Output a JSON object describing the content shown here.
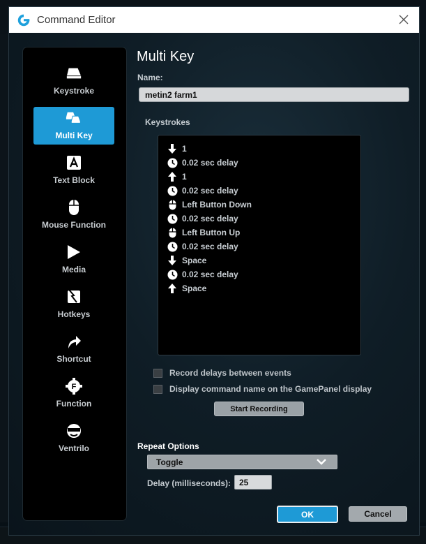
{
  "window": {
    "title": "Command Editor"
  },
  "sidebar": {
    "items": [
      {
        "label": "Keystroke",
        "icon": "keycap-icon",
        "active": false
      },
      {
        "label": "Multi Key",
        "icon": "multi-keycap-icon",
        "active": true
      },
      {
        "label": "Text Block",
        "icon": "letter-a-icon",
        "active": false
      },
      {
        "label": "Mouse Function",
        "icon": "mouse-icon",
        "active": false
      },
      {
        "label": "Media",
        "icon": "play-icon",
        "active": false
      },
      {
        "label": "Hotkeys",
        "icon": "lightning-icon",
        "active": false
      },
      {
        "label": "Shortcut",
        "icon": "shortcut-arrow-icon",
        "active": false
      },
      {
        "label": "Function",
        "icon": "function-gear-icon",
        "active": false
      },
      {
        "label": "Ventrilo",
        "icon": "headset-icon",
        "active": false
      }
    ]
  },
  "main": {
    "heading": "Multi Key",
    "name_label": "Name:",
    "name_value": "metin2 farm1",
    "keystrokes_label": "Keystrokes",
    "keystrokes": [
      {
        "icon": "arrow-down-icon",
        "text": "1"
      },
      {
        "icon": "clock-icon",
        "text": "0.02 sec delay"
      },
      {
        "icon": "arrow-up-icon",
        "text": "1"
      },
      {
        "icon": "clock-icon",
        "text": "0.02 sec delay"
      },
      {
        "icon": "mouse-icon",
        "text": "Left Button Down"
      },
      {
        "icon": "clock-icon",
        "text": "0.02 sec delay"
      },
      {
        "icon": "mouse-icon",
        "text": "Left Button Up"
      },
      {
        "icon": "clock-icon",
        "text": "0.02 sec delay"
      },
      {
        "icon": "arrow-down-icon",
        "text": "Space"
      },
      {
        "icon": "clock-icon",
        "text": "0.02 sec delay"
      },
      {
        "icon": "arrow-up-icon",
        "text": "Space"
      }
    ],
    "record_delays_label": "Record delays between events",
    "display_name_label": "Display command name on the GamePanel display",
    "start_recording_label": "Start Recording",
    "repeat_options_label": "Repeat Options",
    "repeat_mode": "Toggle",
    "delay_label": "Delay (milliseconds):",
    "delay_value": "25",
    "ok_label": "OK",
    "cancel_label": "Cancel"
  },
  "colors": {
    "accent": "#1e9ad6",
    "panel_bg": "#000000",
    "text": "#c8ced3"
  }
}
